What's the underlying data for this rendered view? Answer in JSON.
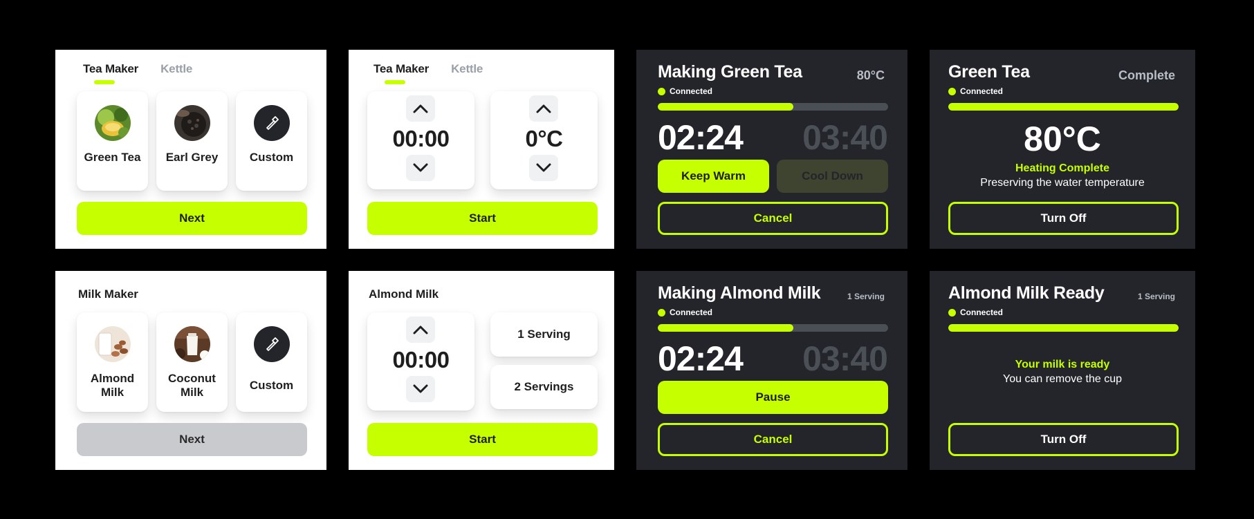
{
  "tea_select": {
    "tabs": [
      {
        "label": "Tea Maker"
      },
      {
        "label": "Kettle"
      }
    ],
    "cards": [
      {
        "label": "Green Tea"
      },
      {
        "label": "Earl Grey"
      },
      {
        "label": "Custom"
      }
    ],
    "next_label": "Next"
  },
  "tea_setup": {
    "tabs": [
      {
        "label": "Tea Maker"
      },
      {
        "label": "Kettle"
      }
    ],
    "time": "00:00",
    "temperature": "0°C",
    "start_label": "Start"
  },
  "making_tea": {
    "title": "Making Green Tea",
    "temperature": "80°C",
    "status": "Connected",
    "progress": 0.59,
    "elapsed": "02:24",
    "total": "03:40",
    "keep_warm_label": "Keep Warm",
    "cool_down_label": "Cool Down",
    "cancel_label": "Cancel"
  },
  "tea_complete": {
    "title": "Green Tea",
    "state": "Complete",
    "status": "Connected",
    "progress": 1.0,
    "temperature": "80°C",
    "message_primary": "Heating Complete",
    "message_secondary": "Preserving the water temperature",
    "turn_off_label": "Turn Off"
  },
  "milk_select": {
    "title": "Milk Maker",
    "cards": [
      {
        "label": "Almond Milk"
      },
      {
        "label": "Coconut Milk"
      },
      {
        "label": "Custom"
      }
    ],
    "next_label": "Next"
  },
  "milk_setup": {
    "title": "Almond Milk",
    "time": "00:00",
    "servings": [
      {
        "label": "1 Serving"
      },
      {
        "label": "2 Servings"
      }
    ],
    "start_label": "Start"
  },
  "making_milk": {
    "title": "Making Almond Milk",
    "servings": "1 Serving",
    "status": "Connected",
    "progress": 0.59,
    "elapsed": "02:24",
    "total": "03:40",
    "pause_label": "Pause",
    "cancel_label": "Cancel"
  },
  "milk_ready": {
    "title": "Almond Milk Ready",
    "servings": "1 Serving",
    "status": "Connected",
    "progress": 1.0,
    "message_primary": "Your milk is ready",
    "message_secondary": "You can remove the cup",
    "turn_off_label": "Turn Off"
  },
  "colors": {
    "accent": "#c6ff00",
    "dark_panel": "#23252a",
    "muted_text": "#4b4f56"
  },
  "icons": [
    "chevron-up-icon",
    "chevron-down-icon",
    "hammer-icon",
    "status-dot-icon"
  ]
}
